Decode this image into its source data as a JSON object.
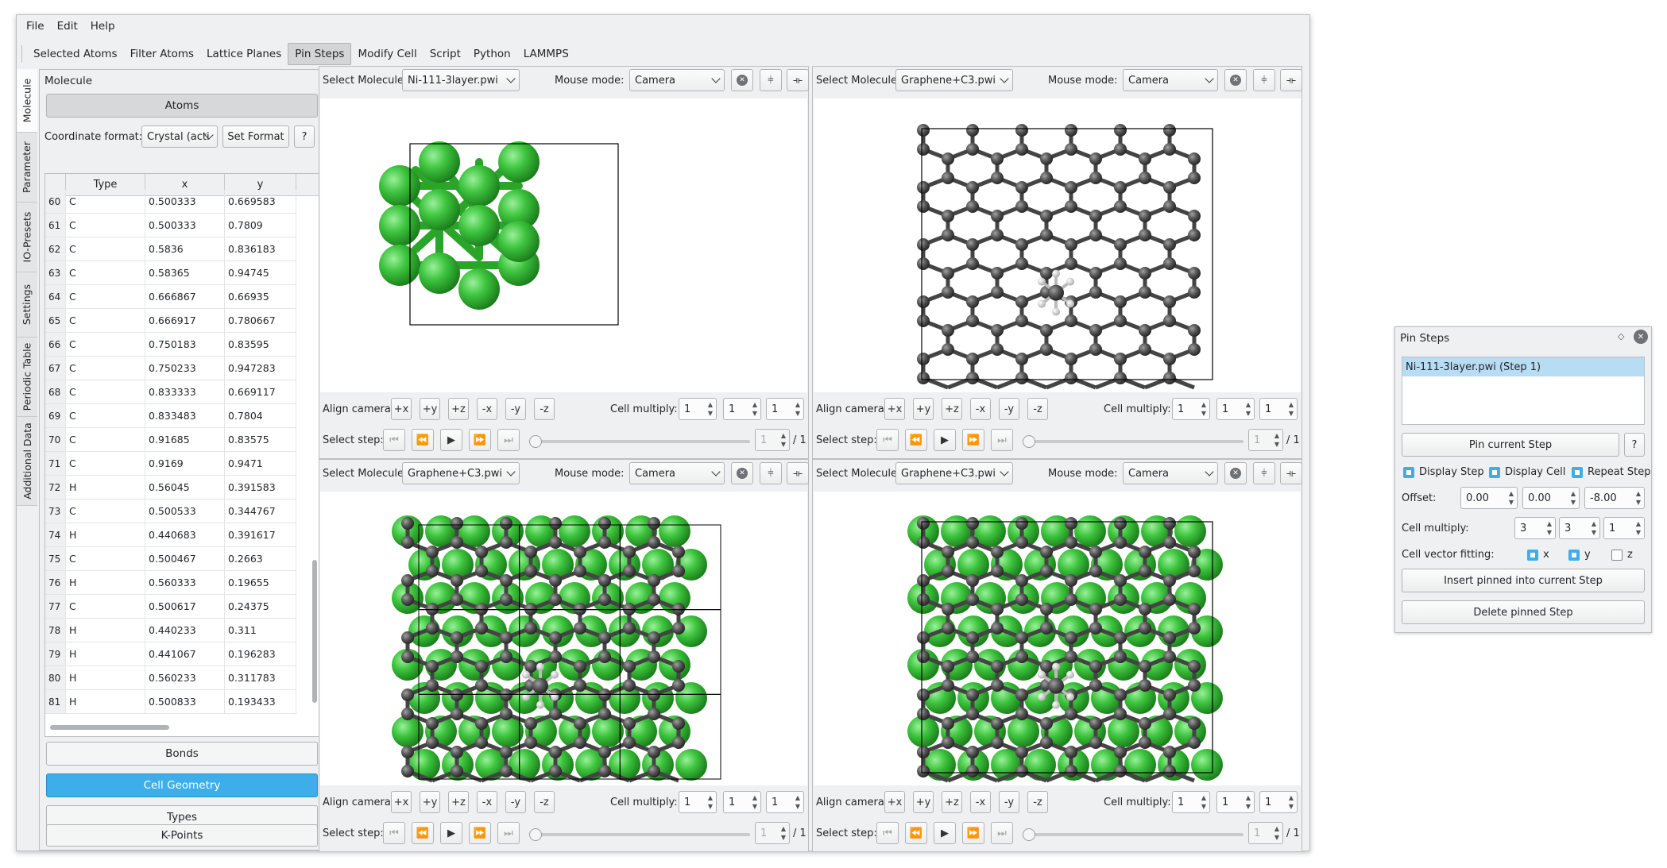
{
  "menu": [
    "File",
    "Edit",
    "Help"
  ],
  "toolbar": [
    "Selected Atoms",
    "Filter Atoms",
    "Lattice Planes",
    "Pin Steps",
    "Modify Cell",
    "Script",
    "Python",
    "LAMMPS"
  ],
  "side_tabs": [
    "Molecule",
    "Parameter",
    "IO-Presets",
    "Settings",
    "Periodic Table",
    "Additional Data"
  ],
  "dock": {
    "title": "Molecule",
    "float_icon": "◇",
    "atoms_label": "Atoms",
    "coord_label": "Coordinate format:",
    "coord_value": "Crystal (acti",
    "set_format": "Set Format",
    "help": "?",
    "columns": [
      "Type",
      "x",
      "y"
    ],
    "rows": [
      [
        "60",
        "C",
        "0.500333",
        "0.669583"
      ],
      [
        "61",
        "C",
        "0.500333",
        "0.7809"
      ],
      [
        "62",
        "C",
        "0.5836",
        "0.836183"
      ],
      [
        "63",
        "C",
        "0.58365",
        "0.94745"
      ],
      [
        "64",
        "C",
        "0.666867",
        "0.66935"
      ],
      [
        "65",
        "C",
        "0.666917",
        "0.780667"
      ],
      [
        "66",
        "C",
        "0.750183",
        "0.83595"
      ],
      [
        "67",
        "C",
        "0.750233",
        "0.947283"
      ],
      [
        "68",
        "C",
        "0.833333",
        "0.669117"
      ],
      [
        "69",
        "C",
        "0.833483",
        "0.7804"
      ],
      [
        "70",
        "C",
        "0.91685",
        "0.83575"
      ],
      [
        "71",
        "C",
        "0.9169",
        "0.9471"
      ],
      [
        "72",
        "H",
        "0.56045",
        "0.391583"
      ],
      [
        "73",
        "C",
        "0.500533",
        "0.344767"
      ],
      [
        "74",
        "H",
        "0.440683",
        "0.391617"
      ],
      [
        "75",
        "C",
        "0.500467",
        "0.2663"
      ],
      [
        "76",
        "H",
        "0.560333",
        "0.19655"
      ],
      [
        "77",
        "C",
        "0.500617",
        "0.24375"
      ],
      [
        "78",
        "H",
        "0.440233",
        "0.311"
      ],
      [
        "79",
        "H",
        "0.441067",
        "0.196283"
      ],
      [
        "80",
        "H",
        "0.560233",
        "0.311783"
      ],
      [
        "81",
        "H",
        "0.500833",
        "0.193433"
      ]
    ],
    "bonds": "Bonds",
    "cell_geometry": "Cell Geometry",
    "types": "Types",
    "kpoints": "K-Points"
  },
  "panes": [
    {
      "molecule": "Ni-111-3layer.pwi",
      "mouse_mode": "Camera",
      "cell": [
        "1",
        "1",
        "1"
      ],
      "step": "1",
      "steps_total": "/ 1"
    },
    {
      "molecule": "Graphene+C3.pwi",
      "mouse_mode": "Camera",
      "cell": [
        "1",
        "1",
        "1"
      ],
      "step": "1",
      "steps_total": "/ 1"
    },
    {
      "molecule": "Graphene+C3.pwi",
      "mouse_mode": "Camera",
      "cell": [
        "1",
        "1",
        "1"
      ],
      "step": "1",
      "steps_total": "/ 1"
    },
    {
      "molecule": "Graphene+C3.pwi",
      "mouse_mode": "Camera",
      "cell": [
        "1",
        "1",
        "1"
      ],
      "step": "1",
      "steps_total": "/ 1"
    }
  ],
  "pane_labels": {
    "select_molecule": "Select Molecule:",
    "mouse_mode": "Mouse mode:",
    "align_camera": "Align camera:",
    "cell_multiply": "Cell multiply:",
    "select_step": "Select step:",
    "align_buttons": [
      "+x",
      "+y",
      "+z",
      "-x",
      "-y",
      "-z"
    ]
  },
  "pin_steps": {
    "title": "Pin Steps",
    "float_icon": "◇",
    "close_icon": "✕",
    "list_item": "Ni-111-3layer.pwi (Step 1)",
    "pin_button": "Pin current Step",
    "help": "?",
    "display_step": "Display Step",
    "display_cell": "Display Cell",
    "repeat_step": "Repeat Step",
    "offset_label": "Offset:",
    "offset": [
      "0.00",
      "0.00",
      "-8.00"
    ],
    "cell_multiply_label": "Cell multiply:",
    "cell_multiply": [
      "3",
      "3",
      "1"
    ],
    "fitting_label": "Cell vector fitting:",
    "fit_x": "x",
    "fit_y": "y",
    "fit_z": "z",
    "insert_button": "Insert pinned into current Step",
    "delete_button": "Delete pinned Step"
  },
  "colors": {
    "accent": "#3daee9",
    "ni_atom": "#3dbb3d",
    "c_atom": "#555555",
    "h_atom": "#dddddd"
  }
}
